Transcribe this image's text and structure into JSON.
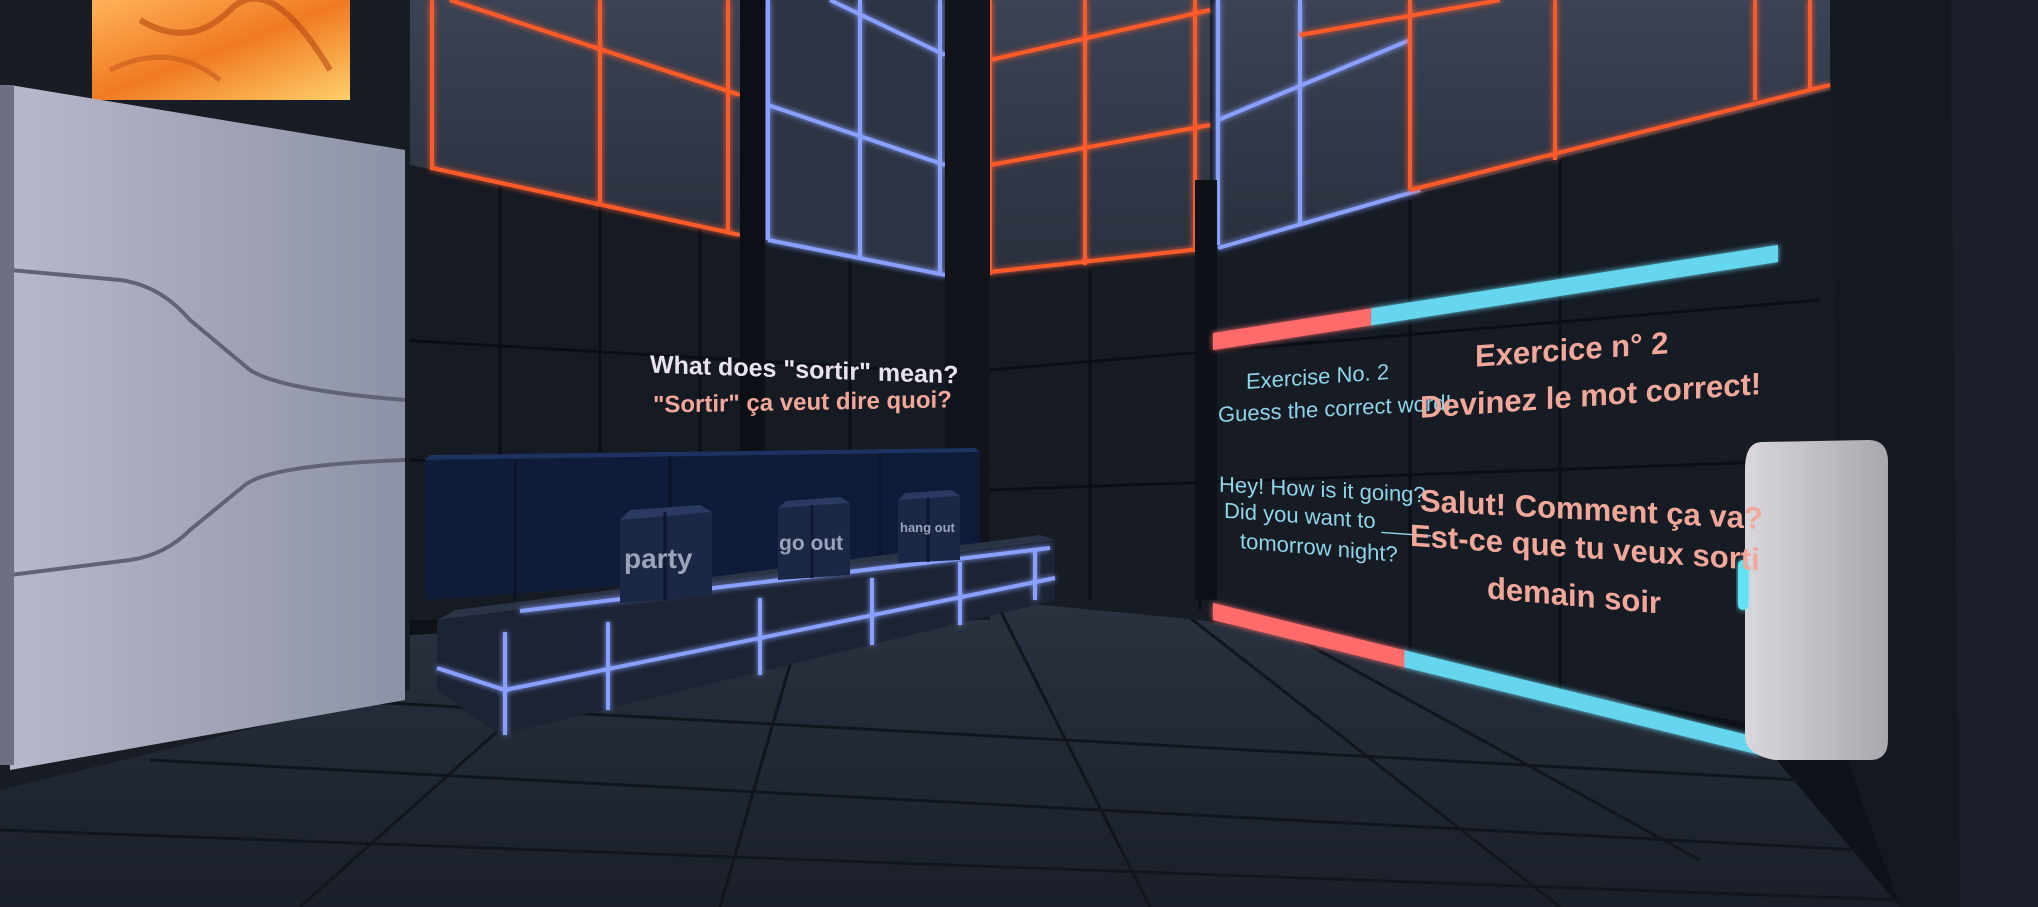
{
  "question": {
    "english": "What does \"sortir\" mean?",
    "french": "\"Sortir\" ça veut dire quoi?"
  },
  "answer_cubes": [
    {
      "label": "party"
    },
    {
      "label": "go out"
    },
    {
      "label": "hang out"
    }
  ],
  "exercise_panel": {
    "english_title": "Exercise No. 2",
    "english_instruction": "Guess the correct word!",
    "english_sentence_line1": "Hey! How is it going?",
    "english_sentence_line2": "Did you want to ____",
    "english_sentence_line3": "tomorrow night?",
    "french_title": "Exercice n° 2",
    "french_instruction": "Devinez le mot correct!",
    "french_sentence_line1": "Salut! Comment ça va?",
    "french_sentence_line2": "Est-ce que tu veux sorti",
    "french_sentence_line3": "demain soir"
  },
  "colors": {
    "neon_orange": "#ff5a2a",
    "neon_blue": "#8aa0ff",
    "progress_red": "#ff6b6b",
    "progress_cyan": "#66d6ef",
    "english_text": "#8fd5ea",
    "french_text": "#f1a89a"
  },
  "progress_bars": [
    {
      "fraction_complete": 0.28
    },
    {
      "fraction_complete": 0.35
    }
  ]
}
